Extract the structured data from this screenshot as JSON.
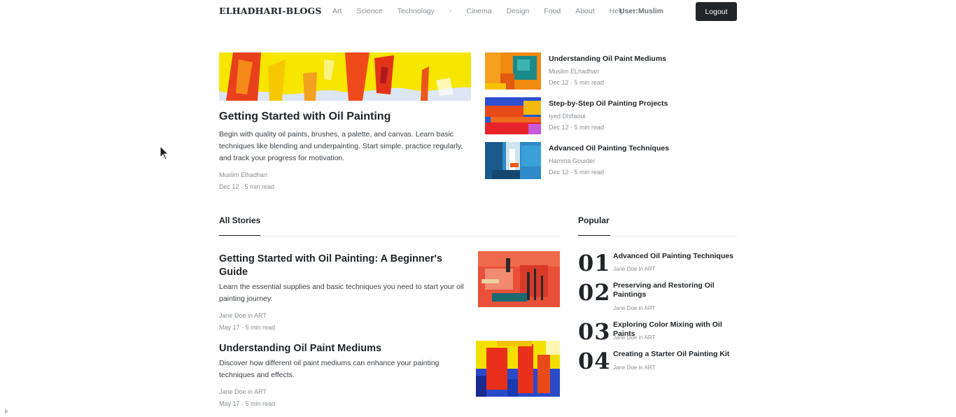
{
  "brand": "ELHADHARI-BLOGS",
  "nav": {
    "links": [
      "Art",
      "Science",
      "Technology",
      "-",
      "Cinema",
      "Design",
      "Food",
      "About",
      "Help"
    ],
    "user": "User:Muslim",
    "logout": "Logout"
  },
  "featured": {
    "title": "Getting Started with Oil Painting",
    "description": "Begin with quality oil paints, brushes, a palette, and canvas. Learn basic techniques like blending and underpainting. Start simple, practice regularly, and track your progress for motivation.",
    "author": "Muslim Elhadhari",
    "meta": "Dec 12 · 5 min read"
  },
  "side_posts": [
    {
      "title": "Understanding Oil Paint Mediums",
      "author": "Muslim ELhadhari",
      "meta": "Dec 12 · 5 min read"
    },
    {
      "title": "Step-by-Step Oil Painting Projects",
      "author": "Iyed Dhifaoui",
      "meta": "Dec 12 · 5 min read"
    },
    {
      "title": "Advanced Oil Painting Techniques",
      "author": "Hamma Gouider",
      "meta": "Dec 12 · 5 min read"
    }
  ],
  "all_stories": {
    "heading": "All Stories",
    "items": [
      {
        "title": "Getting Started with Oil Painting: A Beginner's Guide",
        "description": "Learn the essential supplies and basic techniques you need to start your oil painting journey.",
        "author": "Jane Doe in ART",
        "meta": "May 17 · 5 min read"
      },
      {
        "title": "Understanding Oil Paint Mediums",
        "description": "Discover how different oil paint mediums can enhance your painting techniques and effects.",
        "author": "Jane Doe in ART",
        "meta": "May 17 · 5 min read"
      }
    ]
  },
  "popular": {
    "heading": "Popular",
    "items": [
      {
        "num": "01",
        "title": "Advanced Oil Painting Techniques",
        "meta": "Jane Doe in ART"
      },
      {
        "num": "02",
        "title": "Preserving and Restoring Oil Paintings",
        "meta": "Jane Doe in ART"
      },
      {
        "num": "03",
        "title": "Exploring Color Mixing with Oil Paints",
        "meta": "Jane Doe in ART"
      },
      {
        "num": "04",
        "title": "Creating a Starter Oil Painting Kit",
        "meta": "Jane Doe in ART"
      }
    ]
  }
}
